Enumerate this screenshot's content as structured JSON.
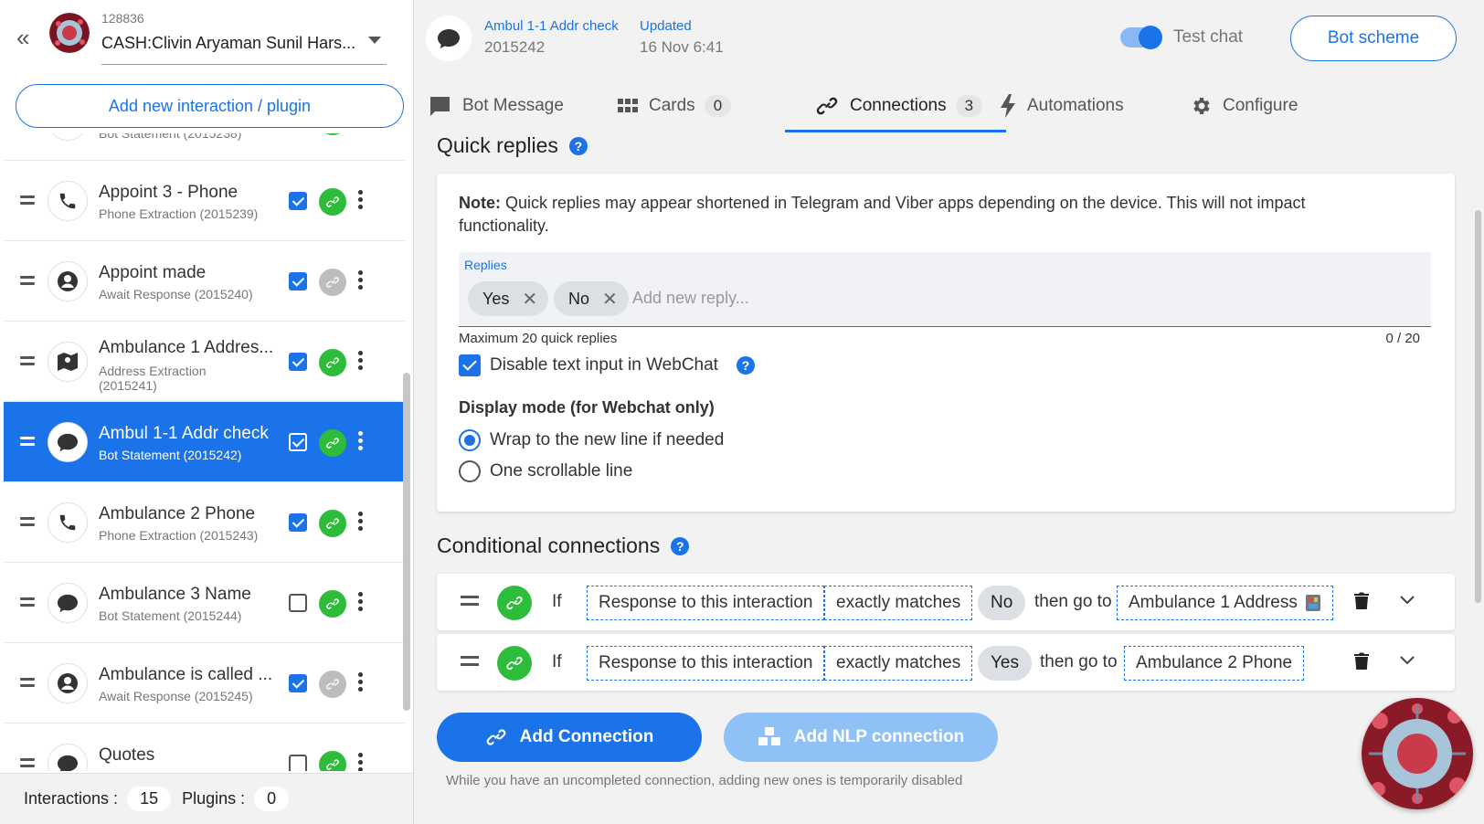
{
  "bot": {
    "id": "128836",
    "name": "CASH:Clivin Aryaman Sunil Hars..."
  },
  "sidebar": {
    "add_button": "Add new interaction / plugin",
    "items": [
      {
        "title": "",
        "subtitle": "Bot Statement (2015238)",
        "icon": "chat-bubble-icon",
        "checked": false,
        "linked": true
      },
      {
        "title": "Appoint 3 - Phone",
        "subtitle": "Phone Extraction (2015239)",
        "icon": "phone-icon",
        "checked": true,
        "linked": true
      },
      {
        "title": "Appoint made",
        "subtitle": "Await Response (2015240)",
        "icon": "user-icon",
        "checked": true,
        "linked": false
      },
      {
        "title": "Ambulance 1 Addres...",
        "subtitle": "Address Extraction",
        "subtitle2": "(2015241)",
        "icon": "map-icon",
        "checked": true,
        "linked": true
      },
      {
        "title": "Ambul 1-1 Addr check",
        "subtitle": "Bot Statement (2015242)",
        "icon": "chat-bubble-icon",
        "checked": true,
        "linked": true,
        "active": true
      },
      {
        "title": "Ambulance 2 Phone",
        "subtitle": "Phone Extraction (2015243)",
        "icon": "phone-icon",
        "checked": true,
        "linked": true
      },
      {
        "title": "Ambulance 3 Name",
        "subtitle": "Bot Statement (2015244)",
        "icon": "chat-bubble-icon",
        "checked": false,
        "linked": true
      },
      {
        "title": "Ambulance is called ...",
        "subtitle": "Await Response (2015245)",
        "icon": "user-icon",
        "checked": true,
        "linked": false
      },
      {
        "title": "Quotes",
        "subtitle": "",
        "icon": "chat-bubble-icon",
        "checked": false,
        "linked": true
      }
    ],
    "footer": {
      "interactions_label": "Interactions :",
      "interactions_count": "15",
      "plugins_label": "Plugins :",
      "plugins_count": "0"
    }
  },
  "header": {
    "interaction_name": "Ambul 1-1 Addr check",
    "interaction_id": "2015242",
    "updated_label": "Updated",
    "updated_value": "16 Nov 6:41",
    "test_chat_label": "Test chat",
    "test_chat_on": true,
    "bot_scheme_button": "Bot scheme"
  },
  "tabs": [
    {
      "label": "Bot Message",
      "icon": "message-icon"
    },
    {
      "label": "Cards",
      "count": "0",
      "icon": "grid-icon"
    },
    {
      "label": "Connections",
      "count": "3",
      "icon": "link-icon",
      "active": true
    },
    {
      "label": "Automations",
      "icon": "bolt-icon"
    },
    {
      "label": "Configure",
      "icon": "gear-icon"
    }
  ],
  "quick_replies": {
    "title": "Quick replies",
    "note_bold": "Note:",
    "note_text": " Quick replies may appear shortened in Telegram and Viber apps depending on the device. This will not impact functionality.",
    "replies_label": "Replies",
    "chips": [
      "Yes",
      "No"
    ],
    "input_placeholder": "Add new reply...",
    "max_text": "Maximum 20 quick replies",
    "counter": "0 / 20",
    "disable_text_label": "Disable text input in WebChat",
    "disable_text_checked": true,
    "display_mode_title": "Display mode (for Webchat only)",
    "display_options": [
      "Wrap to the new line if needed",
      "One scrollable line"
    ],
    "display_selected": 0
  },
  "conditional": {
    "title": "Conditional connections",
    "rows": [
      {
        "if_label": "If",
        "source": "Response to this interaction",
        "operator": "exactly matches",
        "value": "No",
        "then_label": "then go to",
        "target": "Ambulance 1 Address"
      },
      {
        "if_label": "If",
        "source": "Response to this interaction",
        "operator": "exactly matches",
        "value": "Yes",
        "then_label": "then go to",
        "target": "Ambulance 2 Phone"
      }
    ],
    "add_connection_button": "Add Connection",
    "add_nlp_button": "Add NLP connection",
    "hint": "While you have an uncompleted connection, adding new ones is temporarily disabled"
  },
  "colors": {
    "accent": "#1a73e8",
    "link_green": "#2ebd3b",
    "disabled_blue": "#8fc1f7"
  }
}
